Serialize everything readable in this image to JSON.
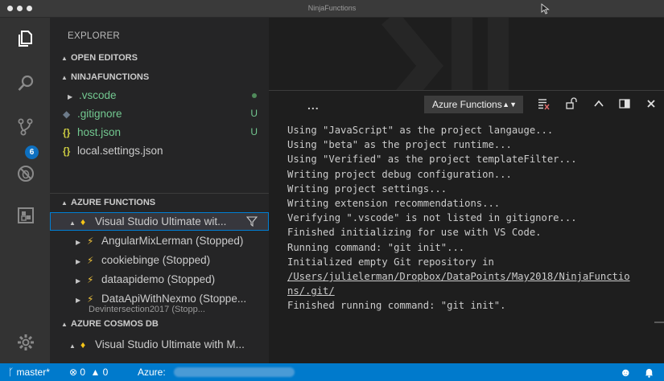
{
  "window": {
    "title": "NinjaFunctions"
  },
  "activity_bar": {
    "icons": [
      "explorer-icon",
      "search-icon",
      "source-control-icon",
      "debug-icon",
      "extensions-icon",
      "settings-gear-icon"
    ],
    "source_control_badge": "6"
  },
  "sidebar": {
    "title": "EXPLORER",
    "open_editors": "OPEN EDITORS",
    "project": "NINJAFUNCTIONS",
    "files": [
      {
        "name": ".vscode",
        "icon": "folder-chevron",
        "status": "dot"
      },
      {
        "name": ".gitignore",
        "icon": "gitignore-icon",
        "status": "U"
      },
      {
        "name": "host.json",
        "icon": "{}",
        "status": "U"
      },
      {
        "name": "local.settings.json",
        "icon": "{}",
        "status": ""
      }
    ],
    "azure_functions": "AZURE FUNCTIONS",
    "subscription": "Visual Studio Ultimate wit...",
    "function_apps": [
      "AngularMixLerman (Stopped)",
      "cookiebinge (Stopped)",
      "dataapidemo (Stopped)",
      "DataApiWithNexmo (Stoppe...",
      "Devintersection2017 (Stopp..."
    ],
    "azure_cosmos": "AZURE COSMOS DB",
    "cosmos_subscription": "Visual Studio Ultimate with M..."
  },
  "panel": {
    "more": "...",
    "selected_output": "Azure Functions",
    "output_lines": [
      "Using \"JavaScript\" as the project langauge...",
      "Using \"beta\" as the project runtime...",
      "Using \"Verified\" as the project templateFilter...",
      "Writing project debug configuration...",
      "Writing project settings...",
      "Writing extension recommendations...",
      "Verifying \".vscode\" is not listed in gitignore...",
      "Finished initializing for use with VS Code.",
      "Running command: \"git init\"...",
      "Initialized empty Git repository in"
    ],
    "link_line_1": "/Users/julielerman/Dropbox/DataPoints/May2018/NinjaFunctio",
    "link_line_2": "ns/.git/",
    "final_line": "Finished running command: \"git init\"."
  },
  "statusbar": {
    "branch": "master*",
    "errors": "0",
    "warnings": "0",
    "azure_label": "Azure:"
  },
  "colors": {
    "accent": "#007acc",
    "untracked": "#73c991",
    "azure_yellow": "#f5c518",
    "function_yellow": "#f0c33c"
  }
}
